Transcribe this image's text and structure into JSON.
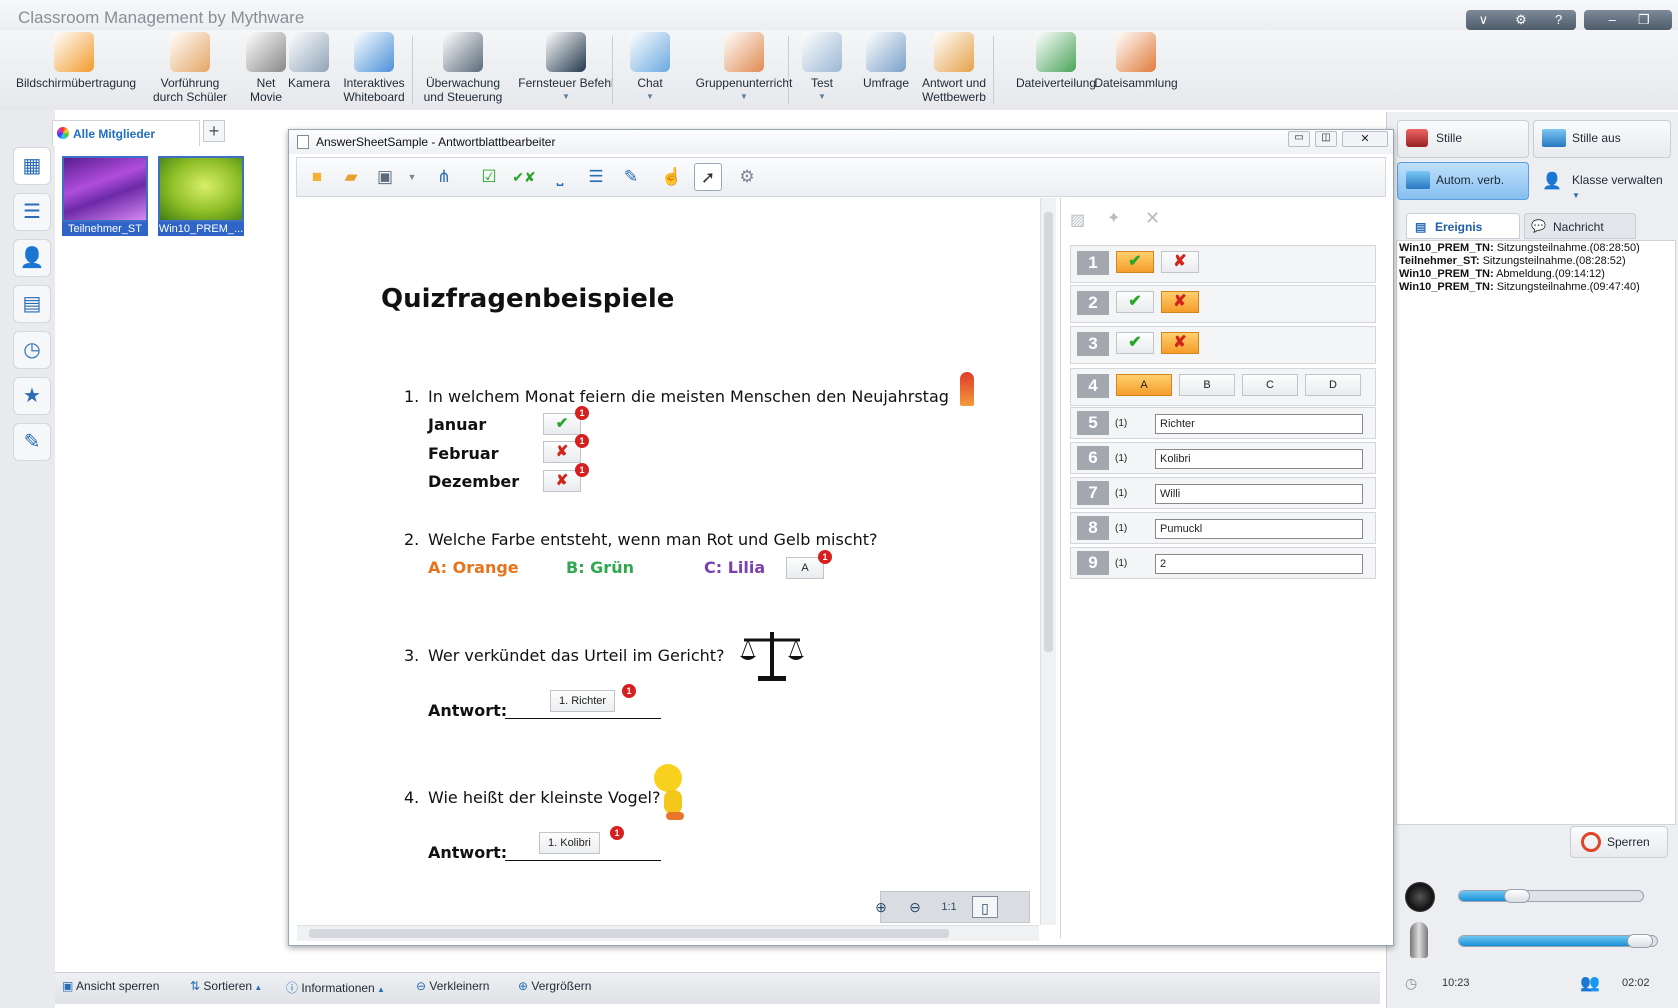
{
  "app": {
    "title": "Classroom Management by Mythware",
    "window_controls": [
      "∨",
      "⚙",
      "?",
      "–",
      "❐",
      "✕"
    ]
  },
  "toolbar": [
    {
      "label": "Bildschirmübertragung",
      "icon": "screen-broadcast-icon"
    },
    {
      "label": "Vorführung\ndurch Schüler",
      "icon": "student-demo-icon"
    },
    {
      "label": "Net\nMovie",
      "icon": "film-reel-icon"
    },
    {
      "label": "Kamera",
      "icon": "webcam-icon"
    },
    {
      "label": "Interaktives\nWhiteboard",
      "icon": "whiteboard-icon"
    },
    {
      "label": "Überwachung\nund Steuerung",
      "icon": "monitor-control-icon"
    },
    {
      "label": "Fernsteuer Befehl",
      "icon": "command-prompt-icon"
    },
    {
      "label": "Chat",
      "icon": "chat-bubbles-icon"
    },
    {
      "label": "Gruppenunterricht",
      "icon": "group-icon"
    },
    {
      "label": "Test",
      "icon": "test-clock-icon"
    },
    {
      "label": "Umfrage",
      "icon": "survey-bars-icon"
    },
    {
      "label": "Antwort und\nWettbewerb",
      "icon": "star-user-icon"
    },
    {
      "label": "Dateiverteilung",
      "icon": "file-send-icon"
    },
    {
      "label": "Dateisammlung",
      "icon": "file-collect-icon"
    }
  ],
  "members": {
    "tab_label": "Alle Mitglieder",
    "add_label": "+",
    "thumbs": [
      {
        "label": "Teilnehmer_ST"
      },
      {
        "label": "Win10_PREM_..."
      }
    ]
  },
  "statusbar": {
    "lock_view": "Ansicht sperren",
    "sort": "Sortieren",
    "info": "Informationen",
    "shrink": "Verkleinern",
    "enlarge": "Vergrößern"
  },
  "right_panel": {
    "silence": "Stille",
    "silence_off": "Stille aus",
    "auto_connect": "Autom. verb.",
    "manage_class": "Klasse verwalten",
    "tab_event": "Ereignis",
    "tab_message": "Nachricht",
    "events": [
      {
        "who": "Win10_PREM_TN:",
        "what": "Sitzungsteilnahme.(08:28:50)"
      },
      {
        "who": "Teilnehmer_ST:",
        "what": "Sitzungsteilnahme.(08:28:52)"
      },
      {
        "who": "Win10_PREM_TN:",
        "what": "Abmeldung.(09:14:12)"
      },
      {
        "who": "Win10_PREM_TN:",
        "what": "Sitzungsteilnahme.(09:47:40)"
      }
    ],
    "lock_button": "Sperren",
    "speaker_volume": 0.29,
    "mic_volume": 0.97,
    "time": "10:23",
    "duration": "02:02"
  },
  "editor": {
    "title": "AnswerSheetSample - Antwortblattbearbeiter",
    "doc_title": "Quizfragenbeispiele",
    "q1": {
      "num": "1.",
      "text": "In welchem Monat feiern die meisten Menschen den Neujahrstag",
      "options": [
        "Januar",
        "Februar",
        "Dezember"
      ]
    },
    "q2": {
      "num": "2.",
      "text": "Welche Farbe entsteht, wenn man Rot und Gelb mischt?",
      "a": "A: Orange",
      "b": "B: Grün",
      "c": "C: Lilia",
      "answer": "A"
    },
    "q3": {
      "num": "3.",
      "text": "Wer verkündet das Urteil im Gericht?",
      "label": "Antwort:",
      "answer": "1.  Richter"
    },
    "q4": {
      "num": "4.",
      "text": "Wie heißt der kleinste Vogel?",
      "label": "Antwort:",
      "answer": "1.  Kolibri"
    },
    "badge": "1",
    "colors": {
      "orange": "#e8731a",
      "green": "#2fa84f",
      "purple": "#7b3fb0"
    }
  },
  "answer_key": {
    "rows": [
      {
        "n": "1",
        "type": "tf",
        "selected": "true"
      },
      {
        "n": "2",
        "type": "tf",
        "selected": "false"
      },
      {
        "n": "3",
        "type": "tf",
        "selected": "false"
      },
      {
        "n": "4",
        "type": "choice",
        "choices": [
          "A",
          "B",
          "C",
          "D"
        ],
        "selected": "A"
      },
      {
        "n": "5",
        "type": "fill",
        "points": "(1)",
        "value": "Richter"
      },
      {
        "n": "6",
        "type": "fill",
        "points": "(1)",
        "value": "Kolibri"
      },
      {
        "n": "7",
        "type": "fill",
        "points": "(1)",
        "value": "Willi"
      },
      {
        "n": "8",
        "type": "fill",
        "points": "(1)",
        "value": "Pumuckl"
      },
      {
        "n": "9",
        "type": "fill",
        "points": "(1)",
        "value": "2"
      }
    ]
  }
}
